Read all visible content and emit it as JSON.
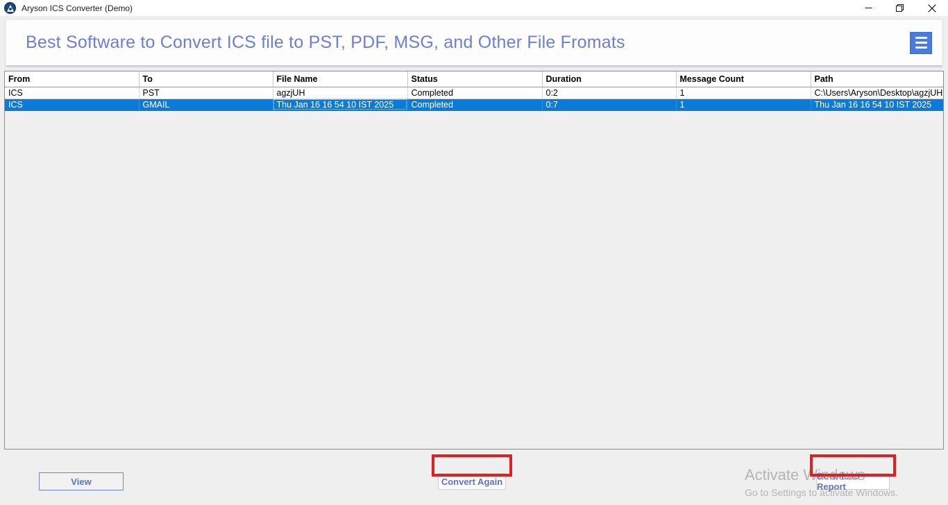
{
  "window": {
    "title": "Aryson ICS Converter (Demo)",
    "app_icon": "aryson-logo-icon",
    "controls": {
      "minimize": "minimize-icon",
      "restore": "restore-icon",
      "close": "close-icon"
    }
  },
  "header": {
    "title": "Best Software to Convert ICS file to PST, PDF, MSG, and Other File Fromats",
    "menu_icon": "hamburger-menu-icon",
    "accent_color": "#6c7fd4",
    "menu_button_color": "#4a7ce0"
  },
  "grid": {
    "columns": [
      "From",
      "To",
      "File Name",
      "Status",
      "Duration",
      "Message Count",
      "Path"
    ],
    "rows": [
      {
        "selected": false,
        "cells": [
          "ICS",
          "PST",
          "agzjUH",
          "Completed",
          "0:2",
          "1",
          "C:\\Users\\Aryson\\Desktop\\agzjUH"
        ]
      },
      {
        "selected": true,
        "cells": [
          "ICS",
          "GMAIL",
          "Thu Jan 16 16 54 10 IST 2025",
          "Completed",
          "0:7",
          "1",
          "Thu Jan 16 16 54 10 IST 2025"
        ]
      }
    ],
    "selection_color": "#0b7ad8"
  },
  "footer": {
    "view_label": "View",
    "convert_again_label": "Convert Again",
    "download_report_label": "Download Report",
    "highlight_color": "#e02020"
  },
  "watermark": {
    "title": "Activate Windows",
    "subtitle": "Go to Settings to activate Windows."
  }
}
